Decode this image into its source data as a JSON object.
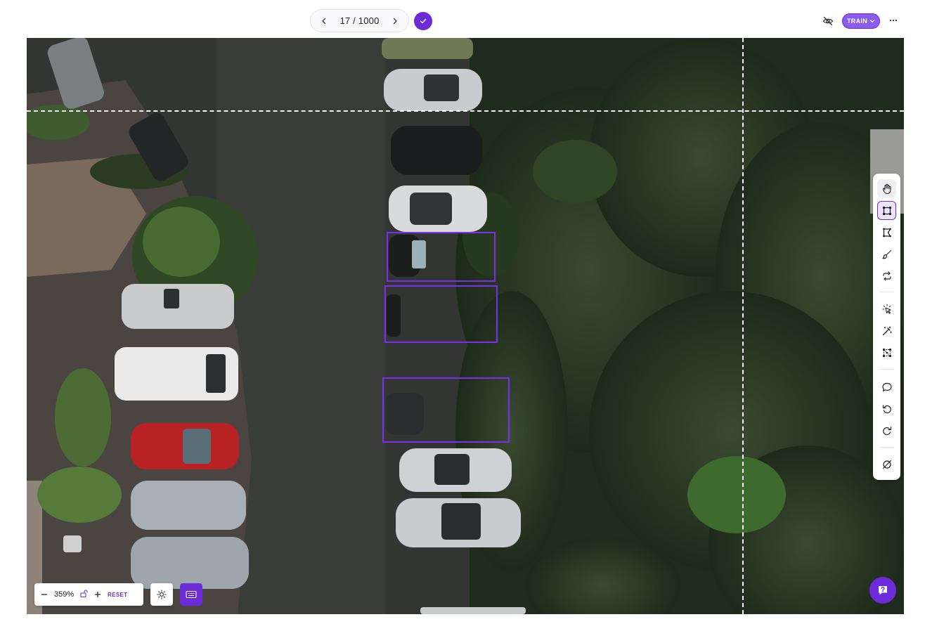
{
  "header": {
    "pager_count": "17 / 1000",
    "train_label": "TRAIN"
  },
  "annotations": {
    "label_color": "#7b2ff0"
  },
  "toolbar": {
    "tools": [
      "hand-icon",
      "bounding-box-icon",
      "polygon-icon",
      "brush-icon",
      "repeat-icon",
      "smart-select-icon",
      "magic-wand-icon",
      "keypoints-icon",
      "comment-icon",
      "undo-icon",
      "redo-icon",
      "null-icon"
    ],
    "active_tool": "bounding-box-icon"
  },
  "zoom": {
    "value": "359%",
    "reset_label": "RESET"
  },
  "colors": {
    "accent": "#6c2bd9",
    "guide": "#ffffff"
  }
}
